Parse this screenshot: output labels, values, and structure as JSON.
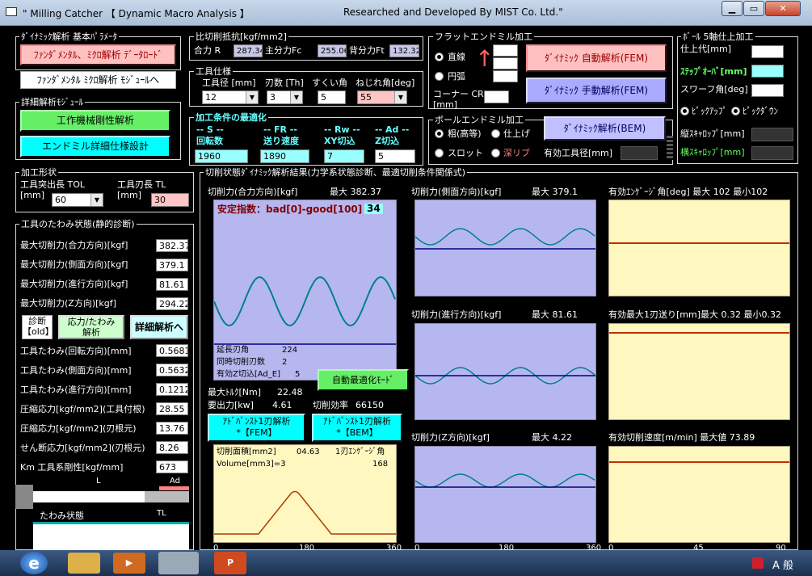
{
  "window": {
    "title_left": "\" Milling Catcher 【 Dynamic Macro Analysis 】",
    "title_right": "Researched and Developed By MIST Co. Ltd.\""
  },
  "basic": {
    "group": "ﾀﾞｲﾅﾐｯｸ解析 基本ﾊﾟﾗﾒｰﾀ",
    "load_btn": "ﾌｧﾝﾀﾞﾒﾝﾀﾙ、ﾐｸﾛ解析 ﾃﾞｰﾀﾛｰﾄﾞ",
    "module_btn": "ﾌｧﾝﾀﾞﾒﾝﾀﾙ ﾐｸﾛ解析 ﾓｼﾞｭｰﾙへ"
  },
  "detail": {
    "group": "詳細解析ﾓｼﾞｭｰﾙ",
    "rigidity_btn": "工作機械剛性解析",
    "spec_btn": "エンドミル詳細仕様設計"
  },
  "shape": {
    "group": "加工形状",
    "tol_label": "工具突出長 TOL",
    "tol_unit": "[mm]",
    "tol_value": "60",
    "tl_label": "工具刃長 TL",
    "tl_unit": "[mm]",
    "tl_value": "30"
  },
  "deflection": {
    "group": "工具のたわみ状態(静的診断)",
    "rows": [
      {
        "label": "最大切削力(合力方向)[kgf]",
        "value": "382.37"
      },
      {
        "label": "最大切削力(側面方向)[kgf]",
        "value": "379.1"
      },
      {
        "label": "最大切削力(進行方向)[kgf]",
        "value": "81.61"
      },
      {
        "label": "最大切削力(Z方向)[kgf]",
        "value": "294.22"
      }
    ],
    "diag_btn": "診断\n【old】",
    "stress_btn": "応力/たわみ\n解析",
    "detail_btn": "詳細解析へ",
    "rows2": [
      {
        "label": "工具たわみ(回転方向)[mm]",
        "value": "0.5681"
      },
      {
        "label": "工具たわみ(側面方向)[mm]",
        "value": "0.5632"
      },
      {
        "label": "工具たわみ(進行方向)[mm]",
        "value": "0.1212"
      },
      {
        "label": "圧縮応力[kgf/mm2](工具付根)",
        "value": "28.55"
      },
      {
        "label": "圧縮応力[kgf/mm2](刃根元)",
        "value": "13.76"
      },
      {
        "label": "せん断応力[kgf/mm2](刃根元)",
        "value": "8.26"
      },
      {
        "label": "Km 工具系剛性[kgf/mm]",
        "value": "673"
      }
    ],
    "bar_L": "L",
    "bar_Ad": "Ad",
    "state_label": "たわみ状態",
    "bar_TL": "TL"
  },
  "resistance": {
    "group": "比切削抵抗[kgf/mm2]",
    "r_label": "合力 R",
    "r_value": "287.34",
    "fc_label": "主分力Fc",
    "fc_value": "255.06",
    "ft_label": "背分力Ft",
    "ft_value": "132.32"
  },
  "tool": {
    "group": "工具仕様",
    "dia_label": "工具径 [mm]",
    "dia_value": "12",
    "teeth_label": "刃数 [Th]",
    "teeth_value": "3",
    "rake_label": "すくい角",
    "rake_value": "5",
    "helix_label": "ねじれ角[deg]",
    "helix_value": "55"
  },
  "optimize": {
    "group": "加工条件の最適化",
    "s_head": "-- S --",
    "fr_head": "-- FR --",
    "rw_head": "-- Rw --",
    "ad_head": "-- Ad --",
    "s_label": "回転数",
    "fr_label": "送り速度",
    "rw_label": "XY切込",
    "ad_label": "Z切込",
    "s_value": "1960",
    "fr_value": "1890",
    "rw_value": "7",
    "ad_value": "5"
  },
  "flat": {
    "group": "フラットエンドミル加工",
    "straight": "直線",
    "arc": "円弧",
    "corner_label": "コーナー CR\n[mm]",
    "auto_btn": "ﾀﾞｲﾅﾐｯｸ 自動解析(FEM)",
    "manual_btn": "ﾀﾞｲﾅﾐｯｸ 手動解析(FEM)"
  },
  "ball": {
    "group": "ボールエンドミル加工",
    "rough": "粗(高等)",
    "finish": "仕上げ",
    "slot": "スロット",
    "deep": "深リブ",
    "bem_btn": "ﾀﾞｲﾅﾐｯｸ解析(BEM)",
    "eff_len_label": "有効工具径[mm]"
  },
  "five": {
    "group": "ﾎﾞｰﾙ 5軸仕上加工",
    "allowance": "仕上代[mm]",
    "stepover": "ｽﾃｯﾌﾟｵｰﾊﾞ[mm]",
    "swarf": "スワーフ角[deg]",
    "pickup": "ﾋﾟｯｸｱｯﾌﾟ",
    "pickdown": "ﾋﾟｯｸﾀﾞｳﾝ",
    "v_scallop": "縦ｽｷｬﾛｯﾌﾟ[mm]",
    "h_scallop": "横ｽｷｬﾛｯﾌﾟ[mm]"
  },
  "results": {
    "group": "切削状態ﾀﾞｲﾅﾐｯｸ解析結果(力学系状態診断、最適切削条件関係式)",
    "p1_title": "切削力(合力方向)[kgf]",
    "p1_max": "最大 382.37",
    "stability_label": "安定指数：bad[0]-good[100]",
    "stability_value": "34",
    "ext_angle_label": "延長刃角",
    "ext_angle_value": "224",
    "simul_label": "同時切削刃数",
    "simul_value": "2",
    "eff_z_label": "有効Z切込[Ad_E]",
    "eff_z_value": "5",
    "auto_opt_btn": "自動最適化ﾓｰﾄﾞ",
    "torque_label": "最大ﾄﾙｸ[Nm]",
    "torque_value": "22.48",
    "power_label": "要出力[kw]",
    "power_value": "4.61",
    "eff_rate_label": "切削効率",
    "eff_rate_value": "66150",
    "adv_fem_btn": "ｱﾄﾞﾊﾞﾝｽﾄ1刃解析\n*【FEM】",
    "adv_bem_btn": "ｱﾄﾞﾊﾞﾝｽﾄ1刃解析\n*【BEM】",
    "area_label": "切削面積[mm2]",
    "area_value": "04.63",
    "eng_label": "1刃ｴﾝｹﾞｰｼﾞ角",
    "eng_value": "168",
    "volume_label": "Volume[mm3]=3",
    "p2_title": "切削力(側面方向)[kgf]",
    "p2_max": "最大 379.1",
    "p3_title": "切削力(進行方向)[kgf]",
    "p3_max": "最大 81.61",
    "p4_title": "切削力(Z方向)[kgf]",
    "p4_max": "最大 4.22",
    "p5_title": "有効ｴﾝｹﾞｰｼﾞ角[deg] 最大 102 最小102",
    "p6_title": "有効最大1刃送り[mm]最大 0.32 最小0.32",
    "p7_title": "有効切削速度[m/min] 最大値 73.89",
    "x_ticks_a": [
      "0",
      "180",
      "360"
    ],
    "x_ticks_b": [
      "0",
      "180",
      "360"
    ],
    "x_ticks_c": [
      "0",
      "45",
      "90"
    ]
  },
  "colors": {
    "wave": "#00808a",
    "baseline": "#000080",
    "area_curve": "#b03a00",
    "red_line": "#c03000"
  },
  "taskbar": {
    "ime": "A 般"
  }
}
